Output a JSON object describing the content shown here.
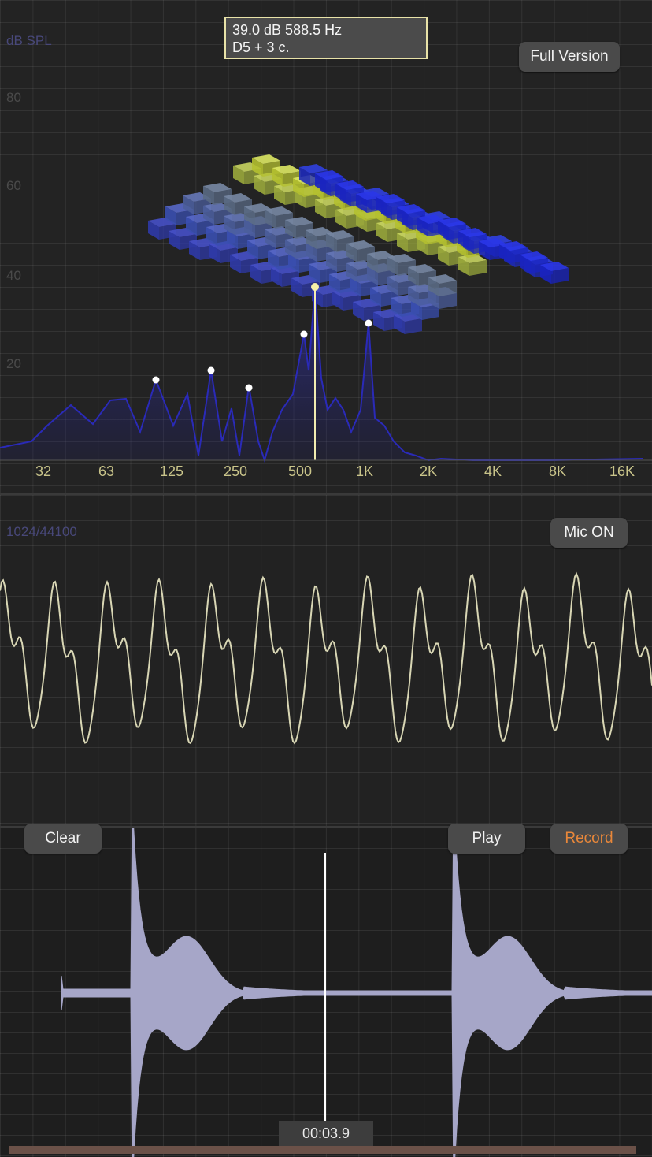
{
  "spectrum": {
    "axis_label": "dB SPL",
    "y_ticks": [
      "80",
      "60",
      "40",
      "20"
    ],
    "x_ticks": [
      "32",
      "63",
      "125",
      "250",
      "500",
      "1K",
      "2K",
      "4K",
      "8K",
      "16K"
    ],
    "readout_line1": "39.0 dB 588.5 Hz",
    "readout_line2": "D5 + 3 c.",
    "full_version_label": "Full Version"
  },
  "oscilloscope": {
    "buffer_label": "1024/44100",
    "mic_label": "Mic",
    "mic_state": "ON"
  },
  "recorder": {
    "clear_label": "Clear",
    "play_label": "Play",
    "record_label": "Record",
    "time": "00:03.9"
  },
  "colors": {
    "spectrum_line": "#2a2ab8",
    "oscilloscope_line": "#d8d6b4",
    "record_accent": "#e8873a",
    "waveform": "#a6a6c8",
    "axis_tick": "#c9c48a"
  }
}
